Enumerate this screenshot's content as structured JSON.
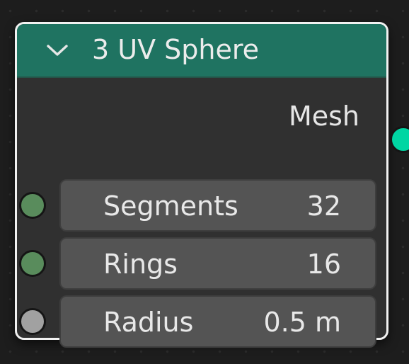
{
  "node": {
    "title": "3 UV Sphere",
    "header_color": "#1f7361",
    "collapse_icon": "chevron-down-icon",
    "outputs": [
      {
        "label": "Mesh",
        "socket_type": "geometry",
        "socket_color": "#00d6a3"
      }
    ],
    "inputs": [
      {
        "label": "Segments",
        "value": "32",
        "socket_type": "integer",
        "socket_color": "#598c5c"
      },
      {
        "label": "Rings",
        "value": "16",
        "socket_type": "integer",
        "socket_color": "#598c5c"
      },
      {
        "label": "Radius",
        "value": "0.5 m",
        "socket_type": "float",
        "socket_color": "#a1a1a1"
      }
    ]
  }
}
